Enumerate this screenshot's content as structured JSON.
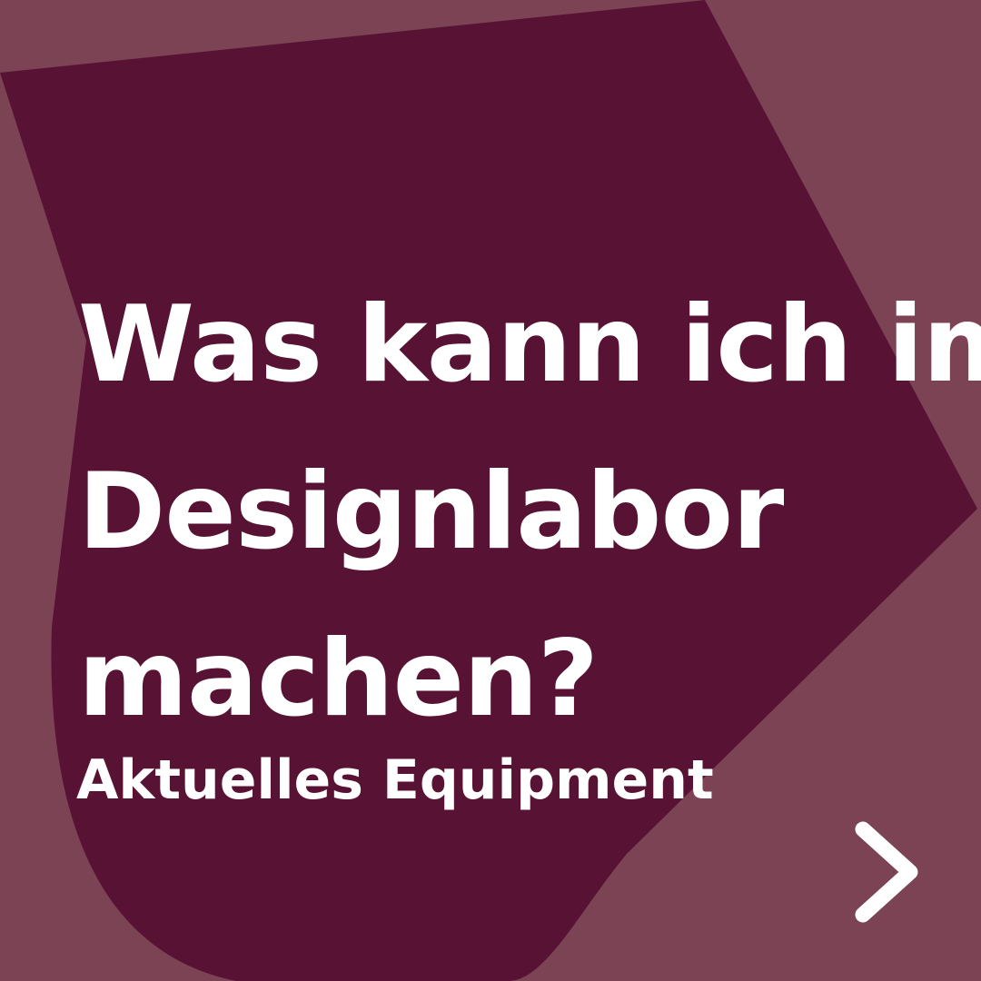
{
  "colors": {
    "background": "#7B4353",
    "shape": "#581233",
    "text": "#ffffff"
  },
  "headline": {
    "line1": "Was kann ich im",
    "line2": "Designlabor",
    "line3": "machen?"
  },
  "subline": "Aktuelles Equipment",
  "next_button": {
    "icon": "chevron-right-icon"
  }
}
